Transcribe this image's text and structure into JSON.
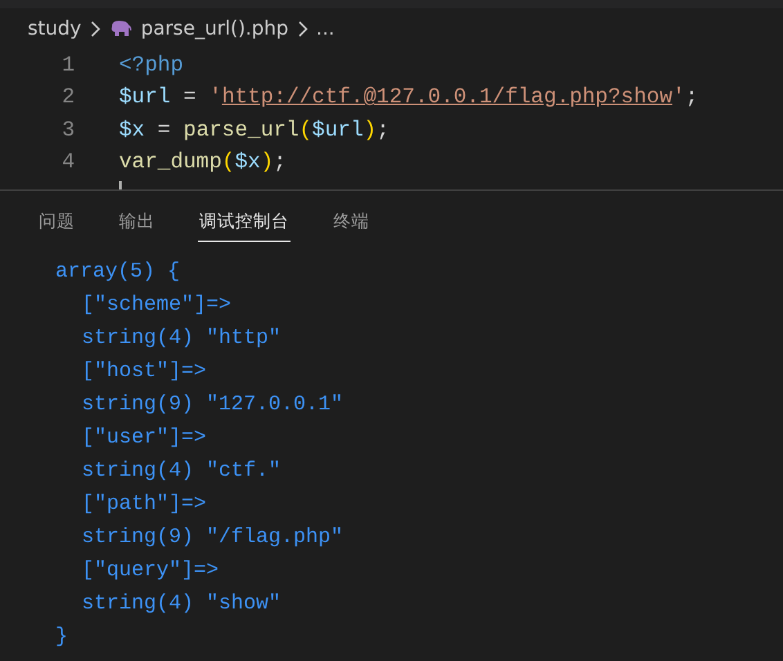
{
  "breadcrumb": [
    {
      "text": "study",
      "kind": "folder"
    },
    {
      "text": "parse_url().php",
      "kind": "php-file"
    },
    {
      "text": "...",
      "kind": "more"
    }
  ],
  "editor": {
    "lines": [
      {
        "number": "1",
        "tokens": [
          {
            "kind": "tag",
            "text": "<?php"
          }
        ]
      },
      {
        "number": "2",
        "tokens": [
          {
            "kind": "variable",
            "text": "$url"
          },
          {
            "kind": "operator",
            "text": " = "
          },
          {
            "kind": "string",
            "text": "'"
          },
          {
            "kind": "link",
            "text": "http://ctf.@127.0.0.1/flag.php?show"
          },
          {
            "kind": "string",
            "text": "'"
          },
          {
            "kind": "operator",
            "text": ";"
          }
        ]
      },
      {
        "number": "3",
        "tokens": [
          {
            "kind": "variable",
            "text": "$x"
          },
          {
            "kind": "operator",
            "text": " = "
          },
          {
            "kind": "function",
            "text": "parse_url"
          },
          {
            "kind": "bracket",
            "text": "("
          },
          {
            "kind": "variable",
            "text": "$url"
          },
          {
            "kind": "bracket",
            "text": ")"
          },
          {
            "kind": "operator",
            "text": ";"
          }
        ]
      },
      {
        "number": "4",
        "tokens": [
          {
            "kind": "function",
            "text": "var_dump"
          },
          {
            "kind": "bracket",
            "text": "("
          },
          {
            "kind": "variable",
            "text": "$x"
          },
          {
            "kind": "bracket",
            "text": ")"
          },
          {
            "kind": "operator",
            "text": ";"
          }
        ]
      }
    ]
  },
  "panel": {
    "tabs": [
      {
        "label": "问题",
        "selected": false
      },
      {
        "label": "输出",
        "selected": false
      },
      {
        "label": "调试控制台",
        "selected": true
      },
      {
        "label": "终端",
        "selected": false
      }
    ],
    "output": [
      {
        "text": "array(5) {",
        "kind": "brace"
      },
      {
        "text": "[\"scheme\"]=>",
        "kind": "entry"
      },
      {
        "text": "string(4) \"http\"",
        "kind": "entry"
      },
      {
        "text": "[\"host\"]=>",
        "kind": "entry"
      },
      {
        "text": "string(9) \"127.0.0.1\"",
        "kind": "entry"
      },
      {
        "text": "[\"user\"]=>",
        "kind": "entry"
      },
      {
        "text": "string(4) \"ctf.\"",
        "kind": "entry"
      },
      {
        "text": "[\"path\"]=>",
        "kind": "entry"
      },
      {
        "text": "string(9) \"/flag.php\"",
        "kind": "entry"
      },
      {
        "text": "[\"query\"]=>",
        "kind": "entry"
      },
      {
        "text": "string(4) \"show\"",
        "kind": "entry"
      },
      {
        "text": "}",
        "kind": "brace"
      }
    ]
  }
}
